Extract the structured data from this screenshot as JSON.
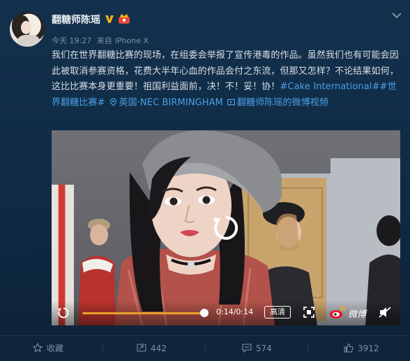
{
  "post": {
    "username": "翻糖师陈瑶",
    "meta": {
      "time": "今天 19:27",
      "source_prefix": "来自",
      "source": "iPhone X"
    },
    "body": {
      "text": "我们在世界翻糖比赛的现场，在组委会举报了宣传港毒的作品。虽然我们也有可能会因此被取消参赛资格，花费大半年心血的作品会付之东流，但那又怎样？不论结果如何，这比比赛本身更重要！祖国利益面前，决！不！妥！协！",
      "hashtag1": "#Cake International#",
      "hashtag2": "#世界翻糖比赛#",
      "location": "英国·NEC BIRMINGHAM",
      "video_link": "翻糖师陈瑶的微博视频"
    }
  },
  "video": {
    "time": "0:14/0:14",
    "quality": "高清",
    "brand": "微博",
    "progress": 1.0
  },
  "actions": {
    "favorite": "收藏",
    "repost": "442",
    "comment": "574",
    "like": "3912"
  },
  "colors": {
    "link": "#4c9fe6",
    "progress": "#e6a127",
    "background": "#0f2238"
  }
}
